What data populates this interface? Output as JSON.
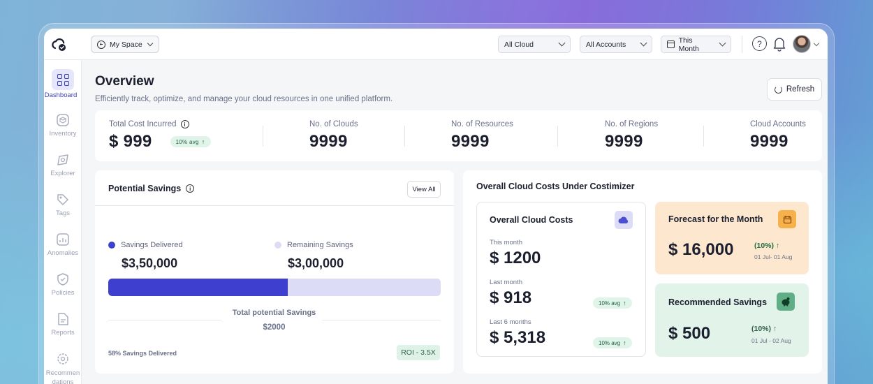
{
  "topbar": {
    "space_label": "My Space",
    "cloud_filter": "All Cloud",
    "accounts_filter": "All Accounts",
    "period_filter": "This Month",
    "help_glyph": "?"
  },
  "sidebar": {
    "items": [
      {
        "label": "Dashboard",
        "icon": "dashboard-icon"
      },
      {
        "label": "Inventory",
        "icon": "inventory-icon"
      },
      {
        "label": "Explorer",
        "icon": "explorer-icon"
      },
      {
        "label": "Tags",
        "icon": "tag-icon"
      },
      {
        "label": "Anomalies",
        "icon": "anomalies-icon"
      },
      {
        "label": "Policies",
        "icon": "shield-icon"
      },
      {
        "label": "Reports",
        "icon": "reports-icon"
      },
      {
        "label": "Recommen dations",
        "icon": "recommendations-icon"
      }
    ]
  },
  "header": {
    "title": "Overview",
    "subtitle": "Efficiently track, optimize, and manage your cloud resources in one unified platform.",
    "refresh_label": "Refresh"
  },
  "stats": {
    "total_cost_label": "Total Cost Incurred",
    "total_cost_value": "$ 999",
    "total_cost_badge": "10% avg",
    "clouds_label": "No. of Clouds",
    "clouds_value": "9999",
    "resources_label": "No. of Resources",
    "resources_value": "9999",
    "regions_label": "No. of Regions",
    "regions_value": "9999",
    "accounts_label": "Cloud Accounts",
    "accounts_value": "9999"
  },
  "savings": {
    "title": "Potential Savings",
    "view_all": "View All",
    "delivered_label": "Savings Delivered",
    "delivered_value": "$3,50,000",
    "remaining_label": "Remaining Savings",
    "remaining_value": "$3,00,000",
    "delivered_fraction": 0.54,
    "total_label": "Total potential Savings",
    "total_value": "$2000",
    "delivered_note": "58% Savings Delivered",
    "roi": "ROI - 3.5X",
    "delivered_color": "#3f3fcf",
    "remaining_color": "#dcdcf6"
  },
  "costs": {
    "title": "Overall Cloud Costs Under Costimizer",
    "overall": {
      "title": "Overall Cloud Costs",
      "this_month_label": "This month",
      "this_month_value": "$ 1200",
      "last_month_label": "Last month",
      "last_month_value": "$ 918",
      "last_month_badge": "10% avg",
      "six_months_label": "Last 6 months",
      "six_months_value": "$ 5,318",
      "six_months_badge": "10% avg"
    },
    "forecast": {
      "title": "Forecast for the Month",
      "value": "$ 16,000",
      "pct": "(10%)",
      "dates": "01 Jul- 01 Aug"
    },
    "recommended": {
      "title": "Recommended Savings",
      "value": "$ 500",
      "pct": "(10%)",
      "dates": "01 Jul - 02 Aug"
    }
  }
}
